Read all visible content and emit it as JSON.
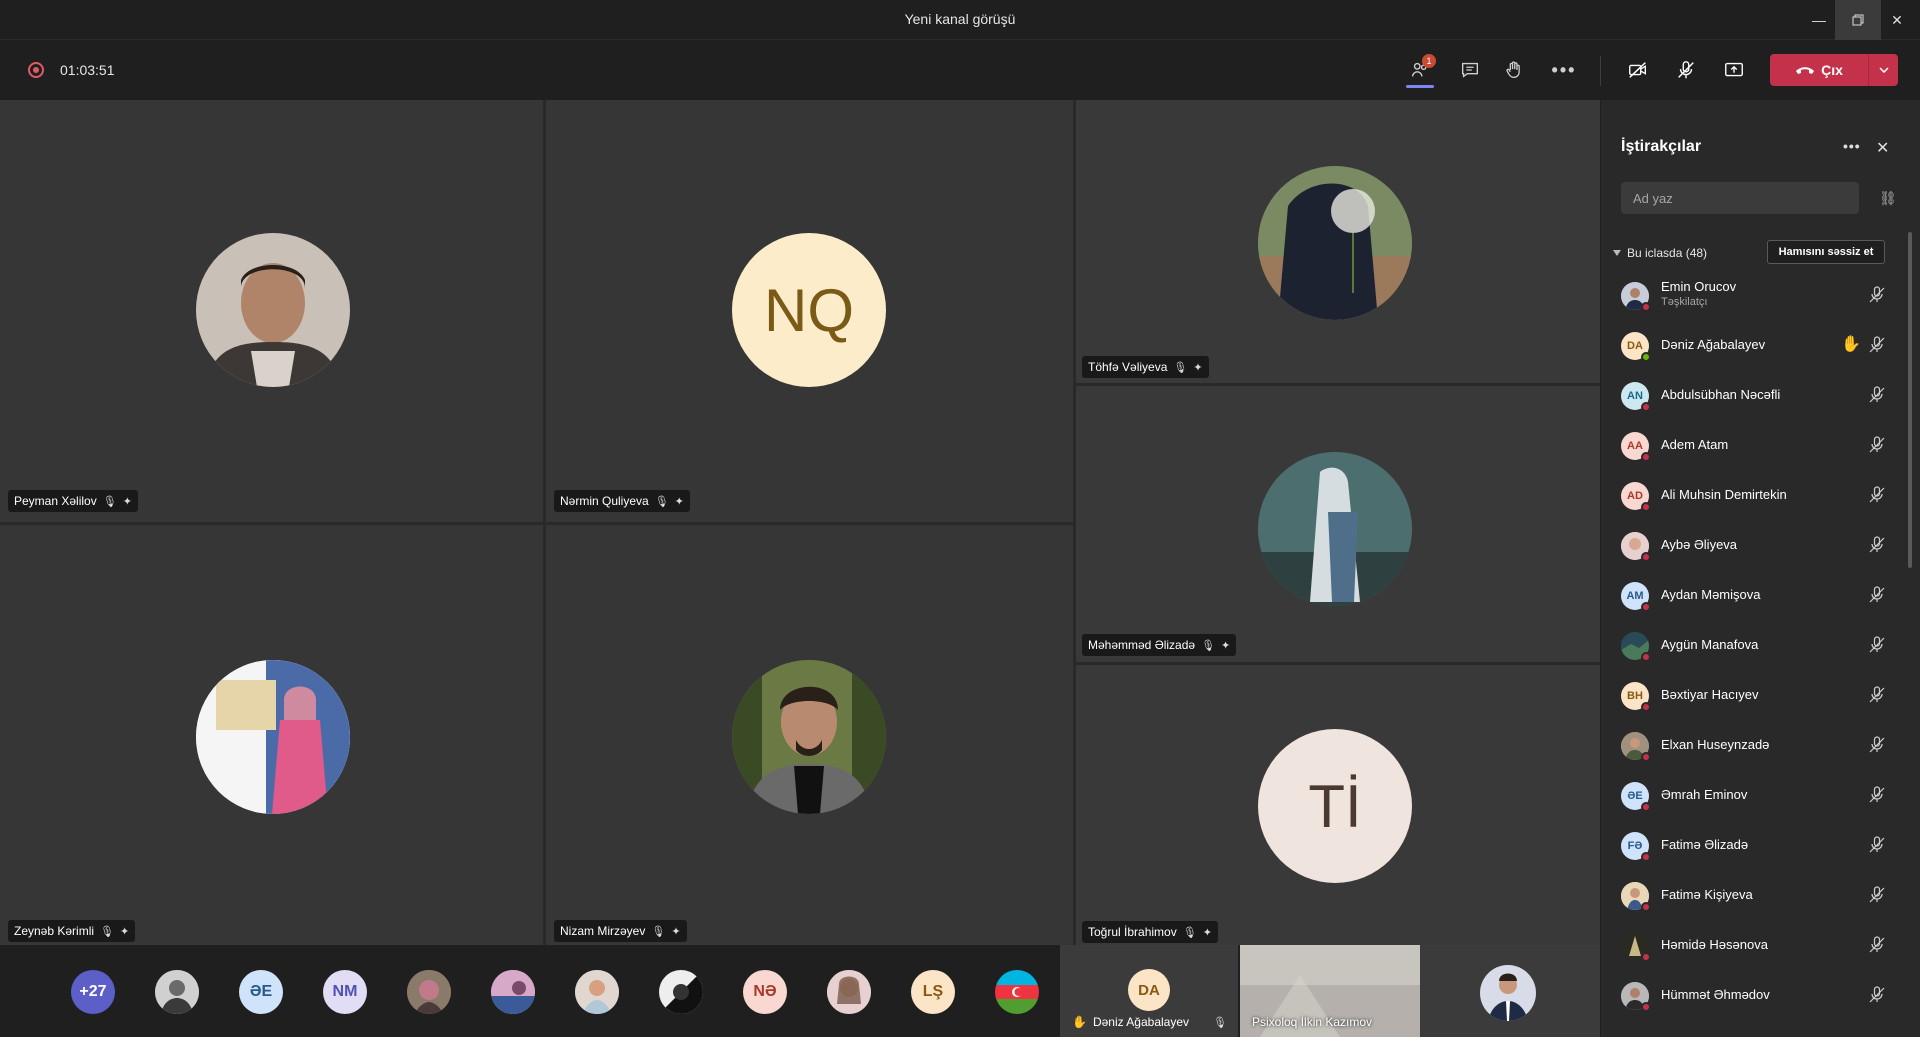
{
  "window": {
    "title": "Yeni kanal görüşü"
  },
  "toolbar": {
    "timer": "01:03:51",
    "participants_badge": "1",
    "leave_label": "Çıx"
  },
  "stage": {
    "tiles": [
      {
        "name": "Peyman Xəlilov"
      },
      {
        "name": "Nərmin Quliyeva",
        "initials": "NQ"
      },
      {
        "name": "Töhfə Vəliyeva"
      },
      {
        "name": "Məhəmməd Əlizadə"
      },
      {
        "name": "Zeynəb Kərimli"
      },
      {
        "name": "Nizam Mirzəyev"
      },
      {
        "name": "Toğrul İbrahimov",
        "initials": "Tİ"
      }
    ]
  },
  "strip": {
    "overflow": "+27",
    "initials": [
      "ƏE",
      "NM",
      "NƏ",
      "LŞ"
    ],
    "bottom_tiles": [
      {
        "name": "Dəniz Ağabalayev",
        "initials": "DA"
      },
      {
        "name": "Psixoloq İlkin Kazımov"
      }
    ]
  },
  "panel": {
    "title": "İştirakçılar",
    "search_placeholder": "Ad yaz",
    "section_label": "Bu iclasda (48)",
    "mute_all_label": "Hamısını səssiz et",
    "participants": [
      {
        "name": "Emin Orucov",
        "role": "Təşkilatçı"
      },
      {
        "name": "Dəniz Ağabalayev",
        "initials": "DA"
      },
      {
        "name": "Abdulsübhan Nəcəfli",
        "initials": "AN"
      },
      {
        "name": "Adem Atam",
        "initials": "AA"
      },
      {
        "name": "Ali Muhsin Demirtekin",
        "initials": "AD"
      },
      {
        "name": "Aybə Əliyeva"
      },
      {
        "name": "Aydan Məmişova",
        "initials": "AM"
      },
      {
        "name": "Aygün Manafova"
      },
      {
        "name": "Bəxtiyar Hacıyev",
        "initials": "BH"
      },
      {
        "name": "Elxan Huseynzadə"
      },
      {
        "name": "Əmrah Eminov",
        "initials": "ƏE"
      },
      {
        "name": "Fatimə Əlizadə",
        "initials": "FƏ"
      },
      {
        "name": "Fatimə Kişiyeva"
      },
      {
        "name": "Həmidə Həsənova"
      },
      {
        "name": "Hümmət Əhmədov"
      }
    ]
  },
  "colors": {
    "accent": "#7f85f5",
    "leave": "#c4314b",
    "badge": "#cc4a31",
    "hand": "#f8d22a"
  }
}
